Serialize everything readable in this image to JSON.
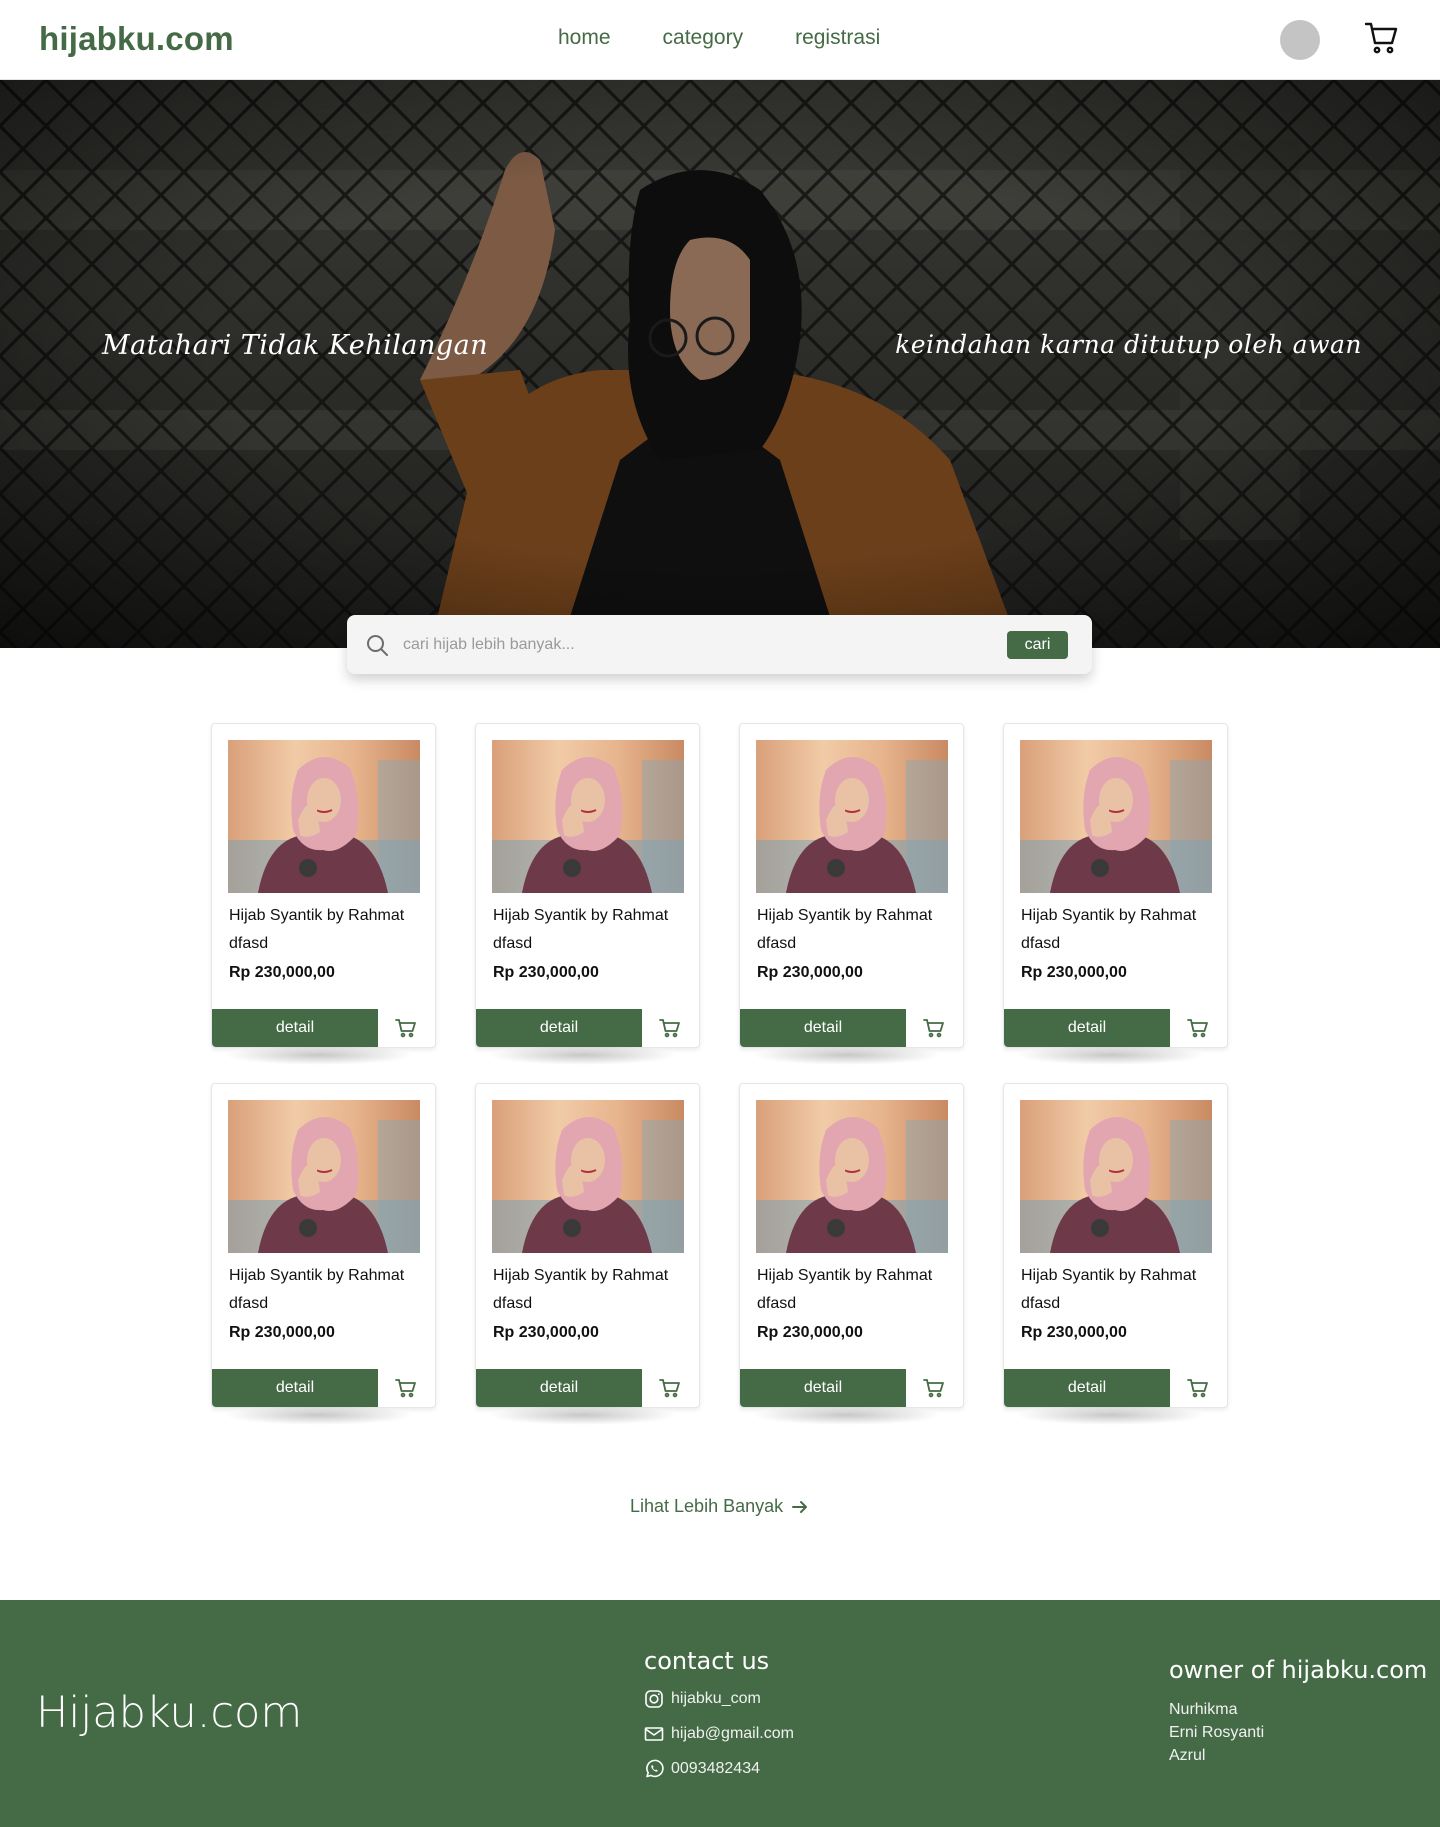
{
  "header": {
    "logo": "hijabku.com",
    "nav": [
      "home",
      "category",
      "registrasi"
    ]
  },
  "hero": {
    "left_text": "Matahari Tidak Kehilangan",
    "right_text": "keindahan karna ditutup oleh awan"
  },
  "search": {
    "placeholder": "cari hijab lebih banyak...",
    "button": "cari"
  },
  "products": [
    {
      "name": "Hijab Syantik by Rahmat",
      "sub": "dfasd",
      "price": "Rp 230,000,00",
      "detail": "detail"
    },
    {
      "name": "Hijab Syantik by Rahmat",
      "sub": "dfasd",
      "price": "Rp 230,000,00",
      "detail": "detail"
    },
    {
      "name": "Hijab Syantik by Rahmat",
      "sub": "dfasd",
      "price": "Rp 230,000,00",
      "detail": "detail"
    },
    {
      "name": "Hijab Syantik by Rahmat",
      "sub": "dfasd",
      "price": "Rp 230,000,00",
      "detail": "detail"
    },
    {
      "name": "Hijab Syantik by Rahmat",
      "sub": "dfasd",
      "price": "Rp 230,000,00",
      "detail": "detail"
    },
    {
      "name": "Hijab Syantik by Rahmat",
      "sub": "dfasd",
      "price": "Rp 230,000,00",
      "detail": "detail"
    },
    {
      "name": "Hijab Syantik by Rahmat",
      "sub": "dfasd",
      "price": "Rp 230,000,00",
      "detail": "detail"
    },
    {
      "name": "Hijab Syantik by Rahmat",
      "sub": "dfasd",
      "price": "Rp 230,000,00",
      "detail": "detail"
    }
  ],
  "more_link": "Lihat Lebih Banyak",
  "footer": {
    "logo": "Hijabku.com",
    "contact_title": "contact us",
    "instagram": "hijabku_com",
    "email": "hijab@gmail.com",
    "phone": "0093482434",
    "owner_title": "owner of hijabku.com",
    "owners": [
      "Nurhikma",
      "Erni Rosyanti",
      "Azrul"
    ]
  },
  "colors": {
    "brand": "#456b46",
    "background": "#ffffff"
  }
}
